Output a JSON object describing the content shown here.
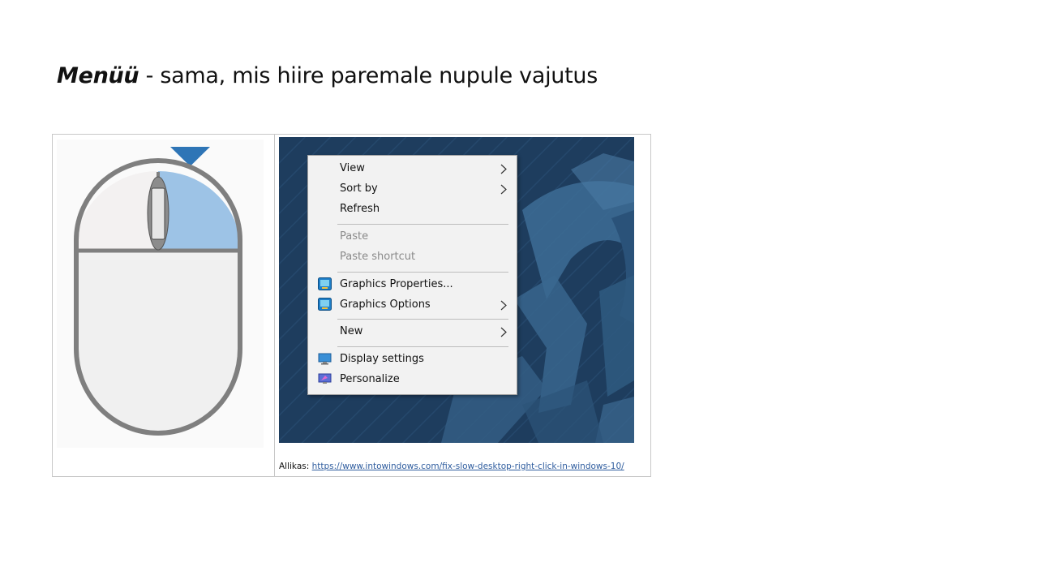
{
  "slide": {
    "title_bold": "Menüü",
    "title_rest": " - sama, mis hiire paremale nupule vajutus"
  },
  "context_menu": {
    "items": [
      {
        "label": "View",
        "has_submenu": true,
        "disabled": false,
        "icon": null
      },
      {
        "label": "Sort by",
        "has_submenu": true,
        "disabled": false,
        "icon": null
      },
      {
        "label": "Refresh",
        "has_submenu": false,
        "disabled": false,
        "icon": null
      },
      {
        "label": "Paste",
        "has_submenu": false,
        "disabled": true,
        "icon": null
      },
      {
        "label": "Paste shortcut",
        "has_submenu": false,
        "disabled": true,
        "icon": null
      },
      {
        "label": "Graphics Properties...",
        "has_submenu": false,
        "disabled": false,
        "icon": "intel-graphics-icon"
      },
      {
        "label": "Graphics Options",
        "has_submenu": true,
        "disabled": false,
        "icon": "intel-graphics-icon"
      },
      {
        "label": "New",
        "has_submenu": true,
        "disabled": false,
        "icon": null
      },
      {
        "label": "Display settings",
        "has_submenu": false,
        "disabled": false,
        "icon": "display-settings-icon"
      },
      {
        "label": "Personalize",
        "has_submenu": false,
        "disabled": false,
        "icon": "personalize-icon"
      }
    ]
  },
  "source": {
    "prefix": "Allikas: ",
    "url_text": "https://www.intowindows.com/fix-slow-desktop-right-click-in-windows-10/"
  },
  "colors": {
    "highlight_button": "#9dc3e6",
    "arrow": "#2e75b6",
    "mouse_outline": "#7f7f7f",
    "desktop_bg": "#1d3b5a",
    "link": "#2e5c9e"
  }
}
